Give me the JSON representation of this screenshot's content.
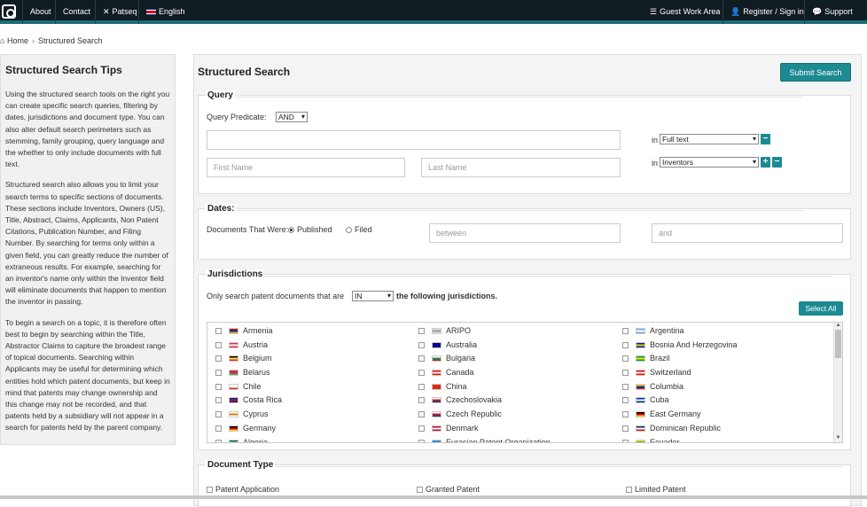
{
  "nav": {
    "about": "About",
    "contact": "Contact",
    "patseq": "Patseq",
    "language": "English",
    "guest": "Guest Work Area",
    "register": "Register / Sign in",
    "support": "Support"
  },
  "breadcrumb": {
    "home": "Home",
    "current": "Structured Search"
  },
  "tips": {
    "title": "Structured Search Tips",
    "p1": "Using the structured search tools on the right you can create specific search queries, filtering by dates, jurisdictions and document type. You can also alter default search perimeters such as stemming, family grouping, query language and the whether to only include documents with full text.",
    "p2": "Structured search also allows you to limit your search terms to specific sections of documents. These sections include Inventors, Owners (US), Title, Abstract, Claims, Applicants, Non Patent Citations, Publication Number, and Filing Number. By searching for terms only within a given field, you can greatly reduce the number of extraneous results. For example, searching for an inventor's name only within the Inventor field will eliminate documents that happen to mention the inventor in passing.",
    "p3": "To begin a search on a topic, it is therefore often best to begin by searching within the Title, Abstractor Claims to capture the broadest range of topical documents. Searching within Applicants may be useful for determining which entities hold which patent documents, but keep in mind that patents may change ownership and this change may not be recorded, and that patents held by a subsidiary will not appear in a search for patents held by the parent company."
  },
  "main": {
    "title": "Structured Search",
    "submit": "Submit Search"
  },
  "query": {
    "legend": "Query",
    "predicate_label": "Query Predicate:",
    "predicate_value": "AND",
    "row1_value": "",
    "in_label": "in",
    "row1_field": "Full text",
    "first_name_placeholder": "First Name",
    "last_name_placeholder": "Last Name",
    "row2_field": "Inventors",
    "minus": "−",
    "plus": "+"
  },
  "dates": {
    "legend": "Dates:",
    "label": "Documents That Were:",
    "published": "Published",
    "filed": "Filed",
    "between_placeholder": "between",
    "and_placeholder": "and"
  },
  "jurisdictions": {
    "legend": "Jurisdictions",
    "label_pre": "Only search patent documents that are",
    "mode": "IN",
    "label_post": "the following jurisdictions.",
    "select_all": "Select All",
    "col1": [
      "Armenia",
      "Austria",
      "Belgium",
      "Belarus",
      "Chile",
      "Costa Rica",
      "Cyprus",
      "Germany",
      "Algeria"
    ],
    "col2": [
      "ARIPO",
      "Australia",
      "Bulgaria",
      "Canada",
      "China",
      "Czechoslovakia",
      "Czech Republic",
      "Denmark",
      "Eurasian Patent Organization"
    ],
    "col3": [
      "Argentina",
      "Bosnia And Herzegovina",
      "Brazil",
      "Switzerland",
      "Columbia",
      "Cuba",
      "East Germany",
      "Dominican Republic",
      "Ecuador"
    ]
  },
  "doc_type": {
    "legend": "Document Type",
    "options": [
      "Patent Application",
      "Granted Patent",
      "Limited Patent"
    ]
  },
  "colors": {
    "accent": "#1c8a92",
    "nav_bg": "#0f1c22"
  }
}
